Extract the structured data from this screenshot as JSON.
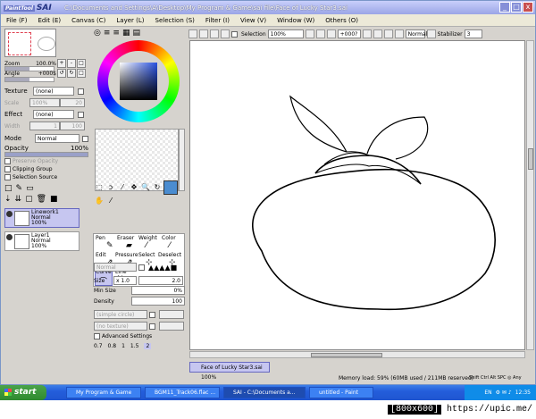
{
  "window": {
    "logo": "SAI",
    "logo_badge": "PaintTool",
    "title": "C:\\Documents and Settings\\A\\Desktop\\My Program & Game\\sai file\\Face of Lucky Star3.sai",
    "buttons": [
      "_",
      "□",
      "x"
    ]
  },
  "menu": [
    "File (F)",
    "Edit (E)",
    "Canvas (C)",
    "Layer (L)",
    "Selection (S)",
    "Filter (I)",
    "View (V)",
    "Window (W)",
    "Others (O)"
  ],
  "nav": {
    "zoom_label": "Zoom",
    "zoom_value": "100.0%",
    "angle_label": "Angle",
    "angle_value": "+000$"
  },
  "layer_props": {
    "texture_label": "Texture",
    "texture_value": "(none)",
    "scale_label": "Scale",
    "scale_value": "100%",
    "scale_num": "20",
    "effect_label": "Effect",
    "effect_value": "(none)",
    "width_label": "Width",
    "width_value": "1",
    "width_num": "100",
    "mode_label": "Mode",
    "mode_value": "Normal",
    "opacity_label": "Opacity",
    "opacity_value": "100%",
    "preserve_opacity": "Preserve Opacity",
    "clipping_group": "Clipping Group",
    "selection_source": "Selection Source"
  },
  "layers": [
    {
      "name": "Linework1",
      "mode": "Normal",
      "opacity": "100%",
      "selected": true
    },
    {
      "name": "Layer1",
      "mode": "Normal",
      "opacity": "100%",
      "selected": false
    }
  ],
  "brushes": {
    "tools": [
      "Pen",
      "Eraser",
      "Weight",
      "Color",
      "Edit",
      "Pressure",
      "Select",
      "Deselect",
      "Curve",
      "Line"
    ],
    "mode_value": "Normal",
    "size_label": "Size",
    "size_mult": "x 1.0",
    "size_value": "2.0",
    "minsize_label": "Min Size",
    "minsize_value": "0%",
    "density_label": "Density",
    "density_value": "100",
    "shape_value": "(simple circle)",
    "texture_value": "(no texture)",
    "advanced_label": "Advanced Settings",
    "size_presets": [
      "0.7",
      "0.8",
      "1",
      "1.5",
      "2"
    ]
  },
  "canvas_toolbar": {
    "selection_label": "Selection",
    "zoom_value": "100%",
    "angle_value": "+000?",
    "mode_value": "Normal",
    "stabilizer_label": "Stabilizer",
    "stabilizer_value": "3"
  },
  "doc_tab": {
    "name": "Face of Lucky Star3.sai",
    "zoom": "100%"
  },
  "status": {
    "memory": "Memory load: 59% (60MB used / 211MB reserved)",
    "keys": "Shift Ctrl Alt SPC ◎ Any"
  },
  "taskbar": {
    "start": "start",
    "tasks": [
      "My Program & Game",
      "BGM11_Track06.flac ...",
      "SAI - C:\\Documents a...",
      "untitled - Paint"
    ],
    "lang": "EN",
    "clock": "12:35"
  },
  "watermark": {
    "size": "[800x600]",
    "url": "https://upic.me/"
  }
}
